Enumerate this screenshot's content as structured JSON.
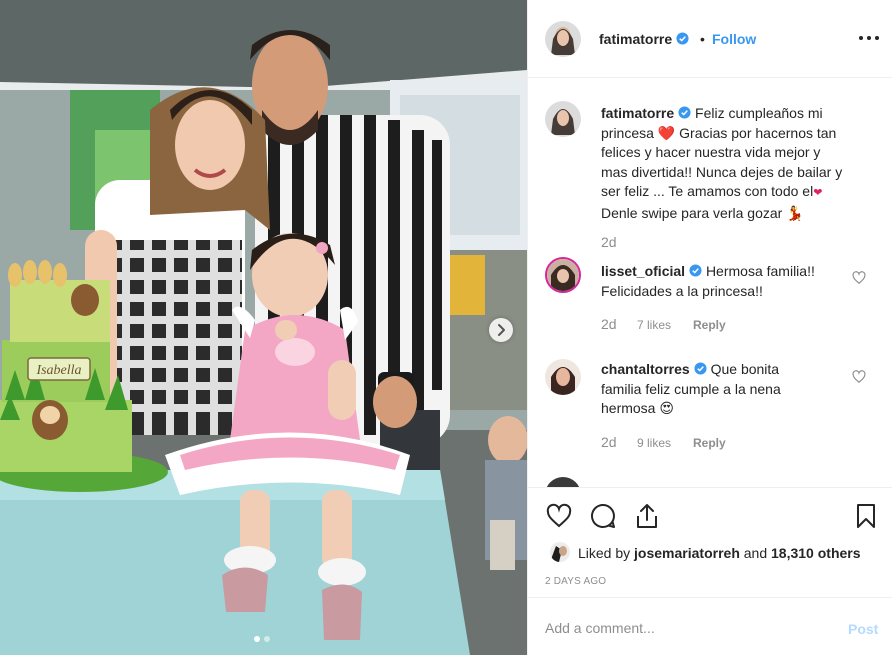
{
  "post": {
    "username": "fatimatorre",
    "separator": "•",
    "follow_label": "Follow",
    "more_icon": "more-dots-icon"
  },
  "comments": [
    {
      "username": "fatimatorre",
      "verified": true,
      "text_line1": "Feliz cumpleaños mi",
      "text_line2": "princesa",
      "text_line2b": "Gracias por hacernos tan",
      "text_line3": "felices y hacer nuestra vida mejor y",
      "text_line4": "mas divertida!! Nunca dejes de bailar y",
      "text_line5": "ser feliz ... Te amamos con todo el",
      "text_line6": "Denle swipe para verla gozar",
      "age": "2d"
    },
    {
      "username": "lisset_oficial",
      "verified": true,
      "text_line1": "Hermosa familia!!",
      "text_line2": "Felicidades a la princesa!!",
      "age": "2d",
      "likes": "7 likes",
      "reply": "Reply"
    },
    {
      "username": "chantaltorres",
      "verified": true,
      "text_line1": "Que bonita",
      "text_line2": "familia feliz cumple a la nena",
      "text_line3": "hermosa",
      "age": "2d",
      "likes": "9 likes",
      "reply": "Reply"
    }
  ],
  "likes_summary": {
    "prefix": "Liked by",
    "liker": "josemariatorreh",
    "suffix": "and 18,310 others"
  },
  "post_date": "2 DAYS AGO",
  "add_comment": {
    "placeholder": "Add a comment...",
    "post_label": "Post"
  },
  "cake_label": "Isabella",
  "carousel": {
    "slide": 1,
    "total": 2
  },
  "colors": {
    "accent": "#3897f0",
    "post_disabled": "#b3dbff",
    "text": "#262626",
    "muted": "#8e8e8e",
    "border": "#efefef"
  }
}
